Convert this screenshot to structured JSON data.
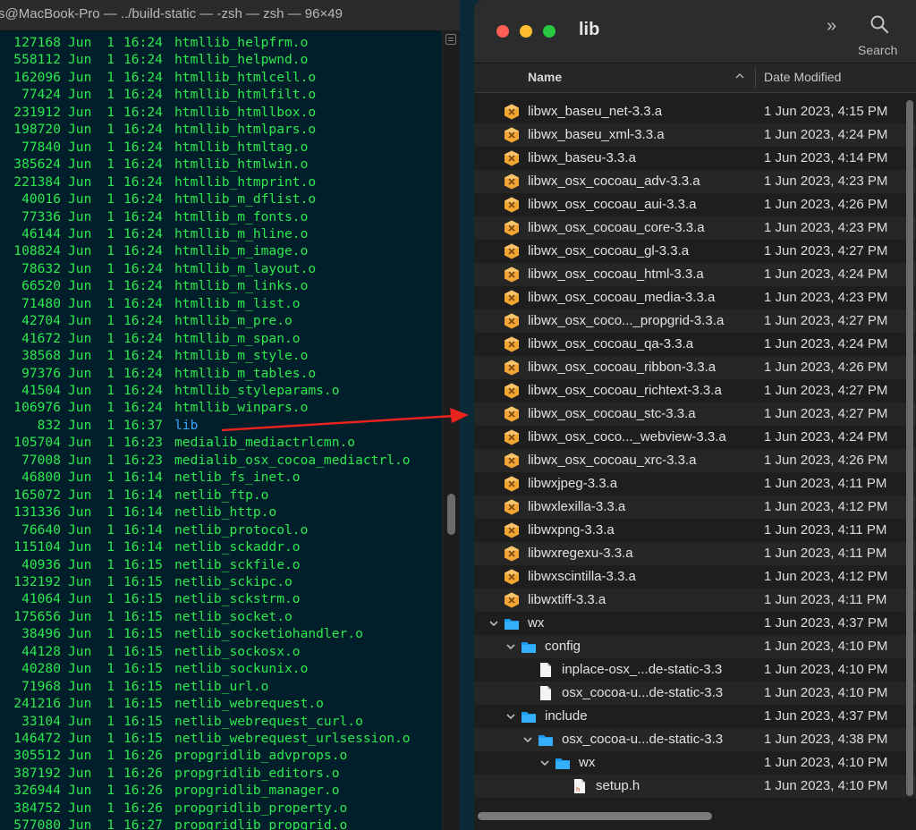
{
  "terminal": {
    "title": "s@MacBook-Pro — ../build-static — -zsh — zsh — 96×49",
    "lines": [
      {
        "size": "127168",
        "month": "Jun",
        "day": "1",
        "time": "16:24",
        "name": "htmllib_helpfrm.o"
      },
      {
        "size": "558112",
        "month": "Jun",
        "day": "1",
        "time": "16:24",
        "name": "htmllib_helpwnd.o"
      },
      {
        "size": "162096",
        "month": "Jun",
        "day": "1",
        "time": "16:24",
        "name": "htmllib_htmlcell.o"
      },
      {
        "size": "77424",
        "month": "Jun",
        "day": "1",
        "time": "16:24",
        "name": "htmllib_htmlfilt.o"
      },
      {
        "size": "231912",
        "month": "Jun",
        "day": "1",
        "time": "16:24",
        "name": "htmllib_htmllbox.o"
      },
      {
        "size": "198720",
        "month": "Jun",
        "day": "1",
        "time": "16:24",
        "name": "htmllib_htmlpars.o"
      },
      {
        "size": "77840",
        "month": "Jun",
        "day": "1",
        "time": "16:24",
        "name": "htmllib_htmltag.o"
      },
      {
        "size": "385624",
        "month": "Jun",
        "day": "1",
        "time": "16:24",
        "name": "htmllib_htmlwin.o"
      },
      {
        "size": "221384",
        "month": "Jun",
        "day": "1",
        "time": "16:24",
        "name": "htmllib_htmprint.o"
      },
      {
        "size": "40016",
        "month": "Jun",
        "day": "1",
        "time": "16:24",
        "name": "htmllib_m_dflist.o"
      },
      {
        "size": "77336",
        "month": "Jun",
        "day": "1",
        "time": "16:24",
        "name": "htmllib_m_fonts.o"
      },
      {
        "size": "46144",
        "month": "Jun",
        "day": "1",
        "time": "16:24",
        "name": "htmllib_m_hline.o"
      },
      {
        "size": "108824",
        "month": "Jun",
        "day": "1",
        "time": "16:24",
        "name": "htmllib_m_image.o"
      },
      {
        "size": "78632",
        "month": "Jun",
        "day": "1",
        "time": "16:24",
        "name": "htmllib_m_layout.o"
      },
      {
        "size": "66520",
        "month": "Jun",
        "day": "1",
        "time": "16:24",
        "name": "htmllib_m_links.o"
      },
      {
        "size": "71480",
        "month": "Jun",
        "day": "1",
        "time": "16:24",
        "name": "htmllib_m_list.o"
      },
      {
        "size": "42704",
        "month": "Jun",
        "day": "1",
        "time": "16:24",
        "name": "htmllib_m_pre.o"
      },
      {
        "size": "41672",
        "month": "Jun",
        "day": "1",
        "time": "16:24",
        "name": "htmllib_m_span.o"
      },
      {
        "size": "38568",
        "month": "Jun",
        "day": "1",
        "time": "16:24",
        "name": "htmllib_m_style.o"
      },
      {
        "size": "97376",
        "month": "Jun",
        "day": "1",
        "time": "16:24",
        "name": "htmllib_m_tables.o"
      },
      {
        "size": "41504",
        "month": "Jun",
        "day": "1",
        "time": "16:24",
        "name": "htmllib_styleparams.o"
      },
      {
        "size": "106976",
        "month": "Jun",
        "day": "1",
        "time": "16:24",
        "name": "htmllib_winpars.o"
      },
      {
        "size": "832",
        "month": "Jun",
        "day": "1",
        "time": "16:37",
        "name": "lib",
        "dir": true
      },
      {
        "size": "105704",
        "month": "Jun",
        "day": "1",
        "time": "16:23",
        "name": "medialib_mediactrlcmn.o"
      },
      {
        "size": "77008",
        "month": "Jun",
        "day": "1",
        "time": "16:23",
        "name": "medialib_osx_cocoa_mediactrl.o"
      },
      {
        "size": "46800",
        "month": "Jun",
        "day": "1",
        "time": "16:14",
        "name": "netlib_fs_inet.o"
      },
      {
        "size": "165072",
        "month": "Jun",
        "day": "1",
        "time": "16:14",
        "name": "netlib_ftp.o"
      },
      {
        "size": "131336",
        "month": "Jun",
        "day": "1",
        "time": "16:14",
        "name": "netlib_http.o"
      },
      {
        "size": "76640",
        "month": "Jun",
        "day": "1",
        "time": "16:14",
        "name": "netlib_protocol.o"
      },
      {
        "size": "115104",
        "month": "Jun",
        "day": "1",
        "time": "16:14",
        "name": "netlib_sckaddr.o"
      },
      {
        "size": "40936",
        "month": "Jun",
        "day": "1",
        "time": "16:15",
        "name": "netlib_sckfile.o"
      },
      {
        "size": "132192",
        "month": "Jun",
        "day": "1",
        "time": "16:15",
        "name": "netlib_sckipc.o"
      },
      {
        "size": "41064",
        "month": "Jun",
        "day": "1",
        "time": "16:15",
        "name": "netlib_sckstrm.o"
      },
      {
        "size": "175656",
        "month": "Jun",
        "day": "1",
        "time": "16:15",
        "name": "netlib_socket.o"
      },
      {
        "size": "38496",
        "month": "Jun",
        "day": "1",
        "time": "16:15",
        "name": "netlib_socketiohandler.o"
      },
      {
        "size": "44128",
        "month": "Jun",
        "day": "1",
        "time": "16:15",
        "name": "netlib_sockosx.o"
      },
      {
        "size": "40280",
        "month": "Jun",
        "day": "1",
        "time": "16:15",
        "name": "netlib_sockunix.o"
      },
      {
        "size": "71968",
        "month": "Jun",
        "day": "1",
        "time": "16:15",
        "name": "netlib_url.o"
      },
      {
        "size": "241216",
        "month": "Jun",
        "day": "1",
        "time": "16:15",
        "name": "netlib_webrequest.o"
      },
      {
        "size": "33104",
        "month": "Jun",
        "day": "1",
        "time": "16:15",
        "name": "netlib_webrequest_curl.o"
      },
      {
        "size": "146472",
        "month": "Jun",
        "day": "1",
        "time": "16:15",
        "name": "netlib_webrequest_urlsession.o"
      },
      {
        "size": "305512",
        "month": "Jun",
        "day": "1",
        "time": "16:26",
        "name": "propgridlib_advprops.o"
      },
      {
        "size": "387192",
        "month": "Jun",
        "day": "1",
        "time": "16:26",
        "name": "propgridlib_editors.o"
      },
      {
        "size": "326944",
        "month": "Jun",
        "day": "1",
        "time": "16:26",
        "name": "propgridlib_manager.o"
      },
      {
        "size": "384752",
        "month": "Jun",
        "day": "1",
        "time": "16:26",
        "name": "propgridlib_property.o"
      },
      {
        "size": "577080",
        "month": "Jun",
        "day": "1",
        "time": "16:27",
        "name": "propgridlib_propgrid.o"
      }
    ],
    "colors": {
      "background": "#001f2b",
      "text": "#2ee84e",
      "directory": "#3fa8ff"
    }
  },
  "finder": {
    "title": "lib",
    "search_label": "Search",
    "columns": {
      "name": "Name",
      "date": "Date Modified"
    },
    "rows": [
      {
        "name": "libwx_baseu_net-3.3.a",
        "date": "1 Jun 2023, 4:15 PM",
        "type": "archive",
        "depth": 0
      },
      {
        "name": "libwx_baseu_xml-3.3.a",
        "date": "1 Jun 2023, 4:24 PM",
        "type": "archive",
        "depth": 0
      },
      {
        "name": "libwx_baseu-3.3.a",
        "date": "1 Jun 2023, 4:14 PM",
        "type": "archive",
        "depth": 0
      },
      {
        "name": "libwx_osx_cocoau_adv-3.3.a",
        "date": "1 Jun 2023, 4:23 PM",
        "type": "archive",
        "depth": 0
      },
      {
        "name": "libwx_osx_cocoau_aui-3.3.a",
        "date": "1 Jun 2023, 4:26 PM",
        "type": "archive",
        "depth": 0
      },
      {
        "name": "libwx_osx_cocoau_core-3.3.a",
        "date": "1 Jun 2023, 4:23 PM",
        "type": "archive",
        "depth": 0
      },
      {
        "name": "libwx_osx_cocoau_gl-3.3.a",
        "date": "1 Jun 2023, 4:27 PM",
        "type": "archive",
        "depth": 0
      },
      {
        "name": "libwx_osx_cocoau_html-3.3.a",
        "date": "1 Jun 2023, 4:24 PM",
        "type": "archive",
        "depth": 0
      },
      {
        "name": "libwx_osx_cocoau_media-3.3.a",
        "date": "1 Jun 2023, 4:23 PM",
        "type": "archive",
        "depth": 0
      },
      {
        "name": "libwx_osx_coco..._propgrid-3.3.a",
        "date": "1 Jun 2023, 4:27 PM",
        "type": "archive",
        "depth": 0
      },
      {
        "name": "libwx_osx_cocoau_qa-3.3.a",
        "date": "1 Jun 2023, 4:24 PM",
        "type": "archive",
        "depth": 0
      },
      {
        "name": "libwx_osx_cocoau_ribbon-3.3.a",
        "date": "1 Jun 2023, 4:26 PM",
        "type": "archive",
        "depth": 0
      },
      {
        "name": "libwx_osx_cocoau_richtext-3.3.a",
        "date": "1 Jun 2023, 4:27 PM",
        "type": "archive",
        "depth": 0
      },
      {
        "name": "libwx_osx_cocoau_stc-3.3.a",
        "date": "1 Jun 2023, 4:27 PM",
        "type": "archive",
        "depth": 0
      },
      {
        "name": "libwx_osx_coco..._webview-3.3.a",
        "date": "1 Jun 2023, 4:24 PM",
        "type": "archive",
        "depth": 0
      },
      {
        "name": "libwx_osx_cocoau_xrc-3.3.a",
        "date": "1 Jun 2023, 4:26 PM",
        "type": "archive",
        "depth": 0
      },
      {
        "name": "libwxjpeg-3.3.a",
        "date": "1 Jun 2023, 4:11 PM",
        "type": "archive",
        "depth": 0
      },
      {
        "name": "libwxlexilla-3.3.a",
        "date": "1 Jun 2023, 4:12 PM",
        "type": "archive",
        "depth": 0
      },
      {
        "name": "libwxpng-3.3.a",
        "date": "1 Jun 2023, 4:11 PM",
        "type": "archive",
        "depth": 0
      },
      {
        "name": "libwxregexu-3.3.a",
        "date": "1 Jun 2023, 4:11 PM",
        "type": "archive",
        "depth": 0
      },
      {
        "name": "libwxscintilla-3.3.a",
        "date": "1 Jun 2023, 4:12 PM",
        "type": "archive",
        "depth": 0
      },
      {
        "name": "libwxtiff-3.3.a",
        "date": "1 Jun 2023, 4:11 PM",
        "type": "archive",
        "depth": 0
      },
      {
        "name": "wx",
        "date": "1 Jun 2023, 4:37 PM",
        "type": "folder",
        "depth": 0,
        "expanded": true
      },
      {
        "name": "config",
        "date": "1 Jun 2023, 4:10 PM",
        "type": "folder",
        "depth": 1,
        "expanded": true
      },
      {
        "name": "inplace-osx_...de-static-3.3",
        "date": "1 Jun 2023, 4:10 PM",
        "type": "file",
        "depth": 2
      },
      {
        "name": "osx_cocoa-u...de-static-3.3",
        "date": "1 Jun 2023, 4:10 PM",
        "type": "file",
        "depth": 2
      },
      {
        "name": "include",
        "date": "1 Jun 2023, 4:37 PM",
        "type": "folder",
        "depth": 1,
        "expanded": true
      },
      {
        "name": "osx_cocoa-u...de-static-3.3",
        "date": "1 Jun 2023, 4:38 PM",
        "type": "folder",
        "depth": 2,
        "expanded": true
      },
      {
        "name": "wx",
        "date": "1 Jun 2023, 4:10 PM",
        "type": "folder",
        "depth": 3,
        "expanded": true
      },
      {
        "name": "setup.h",
        "date": "1 Jun 2023, 4:10 PM",
        "type": "header",
        "depth": 4
      }
    ],
    "colors": {
      "archive": "#f2a636",
      "folder": "#1a9bf0",
      "arrow": "#e8231d"
    }
  }
}
